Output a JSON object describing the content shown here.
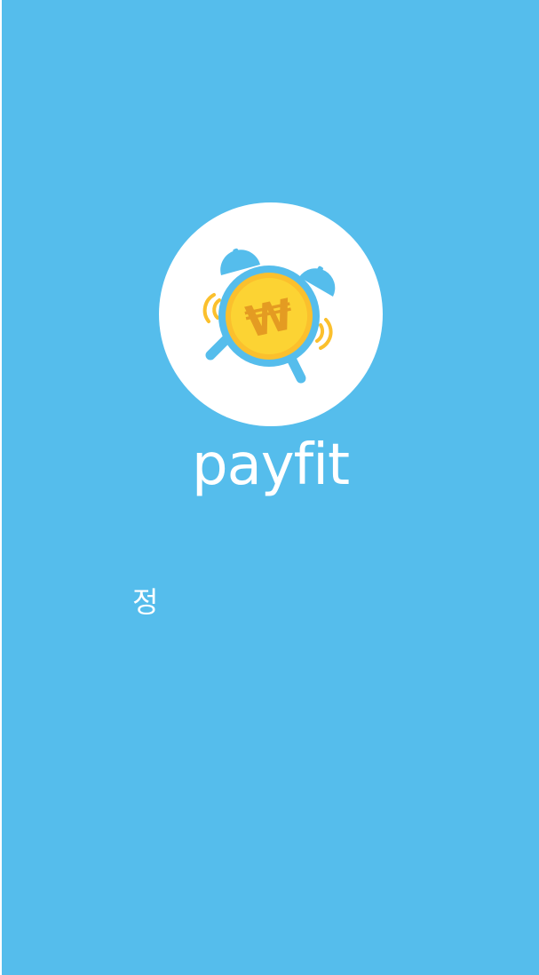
{
  "splash": {
    "app_name": "payfit",
    "loading_text": "정",
    "background_color": "#55bdec",
    "logo": {
      "icon": "alarm-clock-coin-icon",
      "coin_symbol": "₩",
      "circle_color": "#ffffff",
      "clock_color": "#55bdec",
      "coin_color": "#fcd333",
      "coin_rim_color": "#fbc02d",
      "symbol_color": "#e49b22"
    }
  }
}
